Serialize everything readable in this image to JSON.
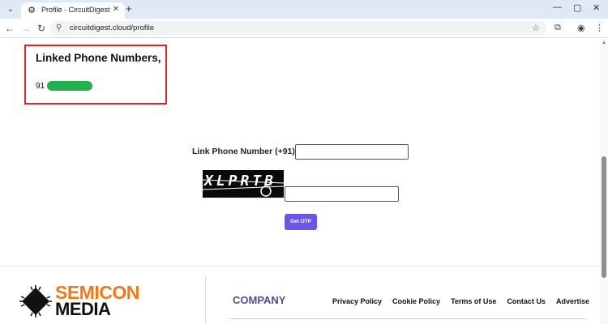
{
  "browser": {
    "tab_title": "Profile - CircuitDigest",
    "url": "circuitdigest.cloud/profile",
    "icons": [
      "tab-search-icon",
      "gear-icon",
      "close-icon",
      "plus-icon",
      "minimize-icon",
      "maximize-icon",
      "back-icon",
      "forward-icon",
      "reload-icon",
      "site-info-icon",
      "star-icon",
      "extensions-icon",
      "profile-icon",
      "menu-icon"
    ]
  },
  "linked": {
    "title": "Linked Phone Numbers,",
    "number_prefix": "91"
  },
  "form": {
    "link_label": "Link Phone Number (+91):",
    "phone_value": "",
    "captcha_text": "XLPRTB",
    "captcha_value": "",
    "otp_button": "Get OTP"
  },
  "footer": {
    "logo_top": "SEMICON",
    "logo_bottom": "MEDIA",
    "company_heading": "COMPANY",
    "links": [
      "Privacy Policy",
      "Cookie Policy",
      "Terms of Use",
      "Contact Us",
      "Advertise"
    ]
  },
  "colors": {
    "highlight_border": "#d9272e",
    "redaction": "#22b14c",
    "otp_button": "#6a56e6",
    "logo_orange": "#f07a1a",
    "company_heading": "#4c4f8f"
  }
}
